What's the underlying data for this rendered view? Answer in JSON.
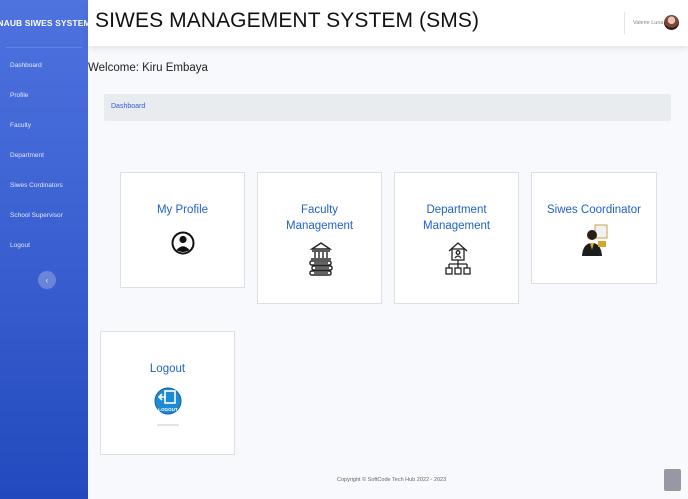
{
  "sidebar": {
    "brand": "NAUB SIWES SYSTEM",
    "items": [
      {
        "label": "Dashboard"
      },
      {
        "label": "Profile"
      },
      {
        "label": "Faculty"
      },
      {
        "label": "Department"
      },
      {
        "label": "Siwes Cordinators"
      },
      {
        "label": "School Supervisor"
      },
      {
        "label": "Logout"
      }
    ],
    "toggle_glyph": "‹"
  },
  "header": {
    "title": "SIWES MANAGEMENT SYSTEM (SMS)",
    "user_name": "Valerie Luna"
  },
  "main": {
    "welcome": "Welcome: Kiru Embaya",
    "breadcrumb": "Dashboard",
    "cards": [
      {
        "title": "My Profile",
        "icon": "user-icon"
      },
      {
        "title": "Faculty Management",
        "icon": "faculty-building-icon"
      },
      {
        "title": "Department Management",
        "icon": "department-tree-icon"
      },
      {
        "title": "Siwes Coordinator",
        "icon": "coordinator-icon"
      },
      {
        "title": "Logout",
        "icon": "logout-icon",
        "icon_text": "LOGOUT"
      }
    ]
  },
  "footer": {
    "copyright": "Copyright © SoftCode Tech Hub 2022 - 2023"
  }
}
